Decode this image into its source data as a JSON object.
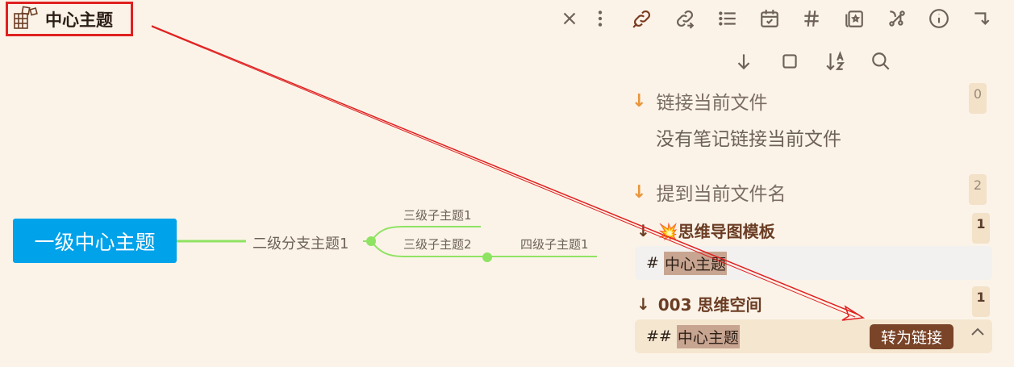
{
  "header": {
    "title": "中心主题",
    "icons": [
      "mindmap-icon",
      "close-icon",
      "more-vertical-icon",
      "link-current-icon",
      "unlinked-icon",
      "outline-icon",
      "calendar-icon",
      "tag-icon",
      "card-icon",
      "graph-icon",
      "info-icon",
      "expand-icon"
    ]
  },
  "toolbar2": {
    "icons": [
      "collapse-all-icon",
      "stop-icon",
      "sort-az-icon",
      "search-icon"
    ]
  },
  "mindmap": {
    "root": "一级中心主题",
    "branch": "二级分支主题1",
    "child1": "三级子主题1",
    "child2": "三级子主题2",
    "grandchild": "四级子主题1",
    "colors": {
      "root_bg": "#00a2ea",
      "line": "#8fe362"
    }
  },
  "backlinks": {
    "linked": {
      "label": "链接当前文件",
      "count": "0",
      "empty_text": "没有笔记链接当前文件"
    },
    "mentions": {
      "label": "提到当前文件名",
      "count": "2",
      "notes": [
        {
          "title": "思维导图模板",
          "emoji": "💥",
          "count": "1",
          "prefix": "#",
          "match": "中心主题"
        },
        {
          "title": "003 思维空间",
          "emoji": "",
          "count": "1",
          "prefix": "##",
          "match": "中心主题",
          "action": "转为链接"
        }
      ]
    }
  }
}
